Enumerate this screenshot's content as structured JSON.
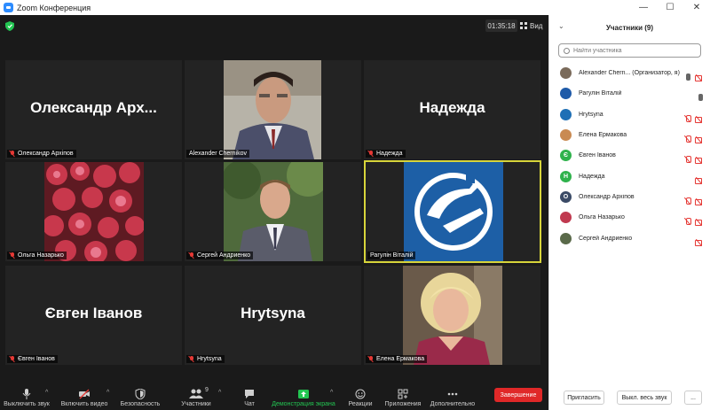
{
  "window": {
    "title": "Zoom Конференция"
  },
  "topbar": {
    "timer": "01:35:18",
    "view_label": "Вид"
  },
  "tiles": [
    {
      "name": "Олександр Архіпов",
      "display": "Олександр Арх...",
      "muted": true
    },
    {
      "name": "Alexander Chernikov",
      "display": "",
      "muted": false
    },
    {
      "name": "Надежда",
      "display": "Надежда",
      "muted": true
    },
    {
      "name": "Ольга Назарько",
      "display": "",
      "muted": true
    },
    {
      "name": "Сергей Андриенко",
      "display": "",
      "muted": true
    },
    {
      "name": "Рагулін Віталій",
      "display": "",
      "muted": false
    },
    {
      "name": "Євген Іванов",
      "display": "Євген Іванов",
      "muted": true
    },
    {
      "name": "Hrytsyna",
      "display": "Hrytsyna",
      "muted": true
    },
    {
      "name": "Елена Ермакова",
      "display": "",
      "muted": true
    }
  ],
  "toolbar": {
    "mute": "Выключить звук",
    "video": "Включить видео",
    "security": "Безопасность",
    "participants": "Участники",
    "participants_count": "9",
    "chat": "Чат",
    "share": "Демонстрация экрана",
    "reactions": "Реакции",
    "apps": "Приложения",
    "more": "Дополнительно",
    "end": "Завершение"
  },
  "panel": {
    "title": "Участники (9)",
    "search_placeholder": "Найти участника",
    "participants": [
      {
        "name": "Alexander Chern... (Организатор, я)",
        "avatar": "",
        "color": "#7a6a5a"
      },
      {
        "name": "Рагулін Віталій",
        "avatar": "",
        "color": "#1e5aa8"
      },
      {
        "name": "Hrytsyna",
        "avatar": "",
        "color": "#1e6fb5"
      },
      {
        "name": "Елена Ермакова",
        "avatar": "",
        "color": "#c98a52"
      },
      {
        "name": "Євген Іванов",
        "avatar": "Є",
        "color": "#2fb24c"
      },
      {
        "name": "Надежда",
        "avatar": "Н",
        "color": "#2fb24c"
      },
      {
        "name": "Олександр Архіпов",
        "avatar": "О",
        "color": "#3a4a66"
      },
      {
        "name": "Ольга Назарько",
        "avatar": "",
        "color": "#c0394f"
      },
      {
        "name": "Сергей Андриенко",
        "avatar": "",
        "color": "#5a6a4a"
      }
    ],
    "invite": "Пригласить",
    "mute_all": "Выкл. весь звук",
    "more": "..."
  }
}
